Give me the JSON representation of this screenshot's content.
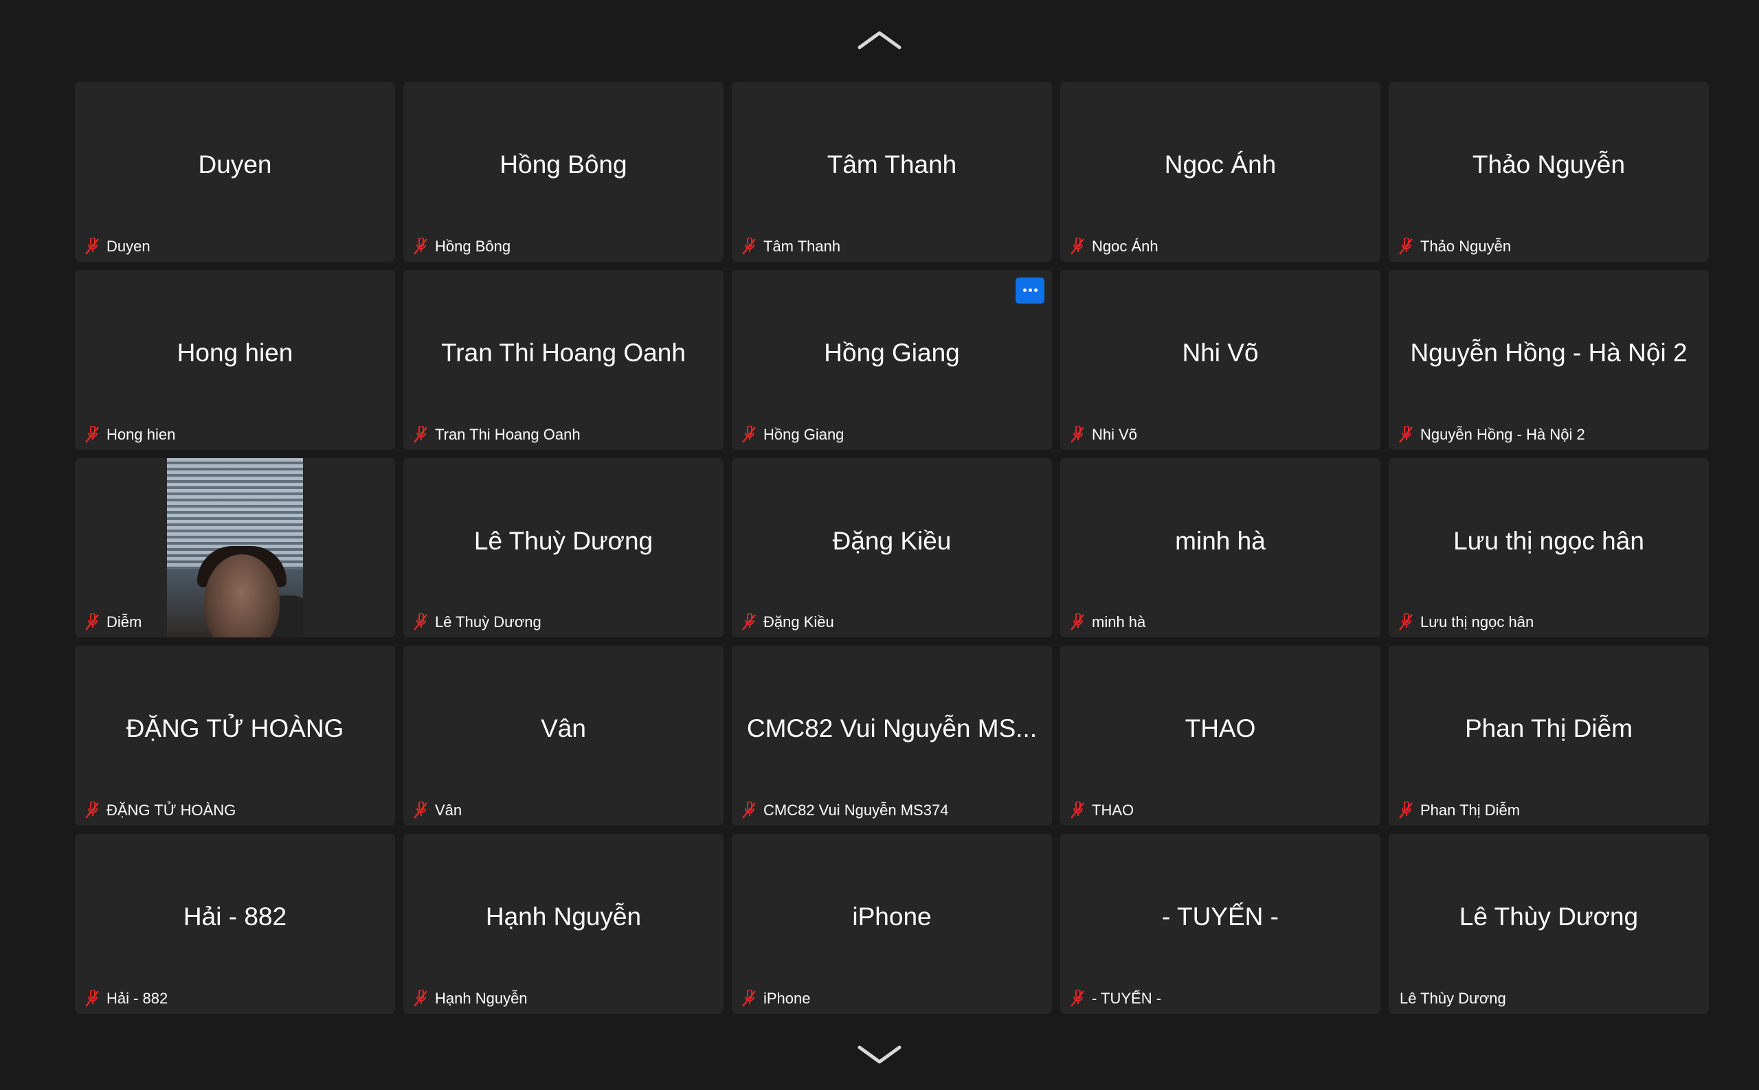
{
  "navigation": {
    "scroll_up": "chevron-up-icon",
    "scroll_down": "chevron-down-icon"
  },
  "colors": {
    "background": "#1a1a1a",
    "tile": "#262626",
    "mute_icon": "#e02828",
    "more_button": "#0e71eb"
  },
  "participants": [
    {
      "display": "Duyen",
      "label": "Duyen",
      "muted": true
    },
    {
      "display": "Hồng Bông",
      "label": "Hồng Bông",
      "muted": true
    },
    {
      "display": "Tâm Thanh",
      "label": "Tâm Thanh",
      "muted": true
    },
    {
      "display": "Ngoc Ánh",
      "label": "Ngoc Ánh",
      "muted": true
    },
    {
      "display": "Thảo Nguyễn",
      "label": "Thảo Nguyễn",
      "muted": true
    },
    {
      "display": "Hong hien",
      "label": "Hong hien",
      "muted": true
    },
    {
      "display": "Tran Thi Hoang Oanh",
      "label": "Tran Thi Hoang Oanh",
      "muted": true
    },
    {
      "display": "Hồng Giang",
      "label": "Hồng Giang",
      "muted": true,
      "more_button": true
    },
    {
      "display": "Nhi Võ",
      "label": "Nhi Võ",
      "muted": true
    },
    {
      "display": "Nguyễn Hồng - Hà Nội 2",
      "label": "Nguyễn Hồng - Hà Nội 2",
      "muted": true
    },
    {
      "display": "",
      "label": "Diễm",
      "muted": true,
      "video": true
    },
    {
      "display": "Lê Thuỳ Dương",
      "label": "Lê Thuỳ Dương",
      "muted": true
    },
    {
      "display": "Đặng Kiều",
      "label": "Đặng Kiều",
      "muted": true
    },
    {
      "display": "minh hà",
      "label": "minh hà",
      "muted": true
    },
    {
      "display": "Lưu thị ngọc hân",
      "label": "Lưu thị ngọc hân",
      "muted": true
    },
    {
      "display": "ĐẶNG TỬ HOÀNG",
      "label": "ĐẶNG TỬ HOÀNG",
      "muted": true
    },
    {
      "display": "Vân",
      "label": "Vân",
      "muted": true
    },
    {
      "display": "CMC82 Vui Nguyễn MS...",
      "label": "CMC82 Vui Nguyễn MS374",
      "muted": true
    },
    {
      "display": "THAO",
      "label": "THAO",
      "muted": true
    },
    {
      "display": "Phan Thị Diễm",
      "label": "Phan Thị Diễm",
      "muted": true
    },
    {
      "display": "Hải - 882",
      "label": "Hải - 882",
      "muted": true
    },
    {
      "display": "Hạnh Nguyễn",
      "label": "Hạnh Nguyễn",
      "muted": true
    },
    {
      "display": "iPhone",
      "label": "iPhone",
      "muted": true
    },
    {
      "display": "- TUYẾN -",
      "label": "- TUYẾN -",
      "muted": true
    },
    {
      "display": "Lê Thùy Dương",
      "label": "Lê Thùy Dương",
      "muted": false
    }
  ]
}
